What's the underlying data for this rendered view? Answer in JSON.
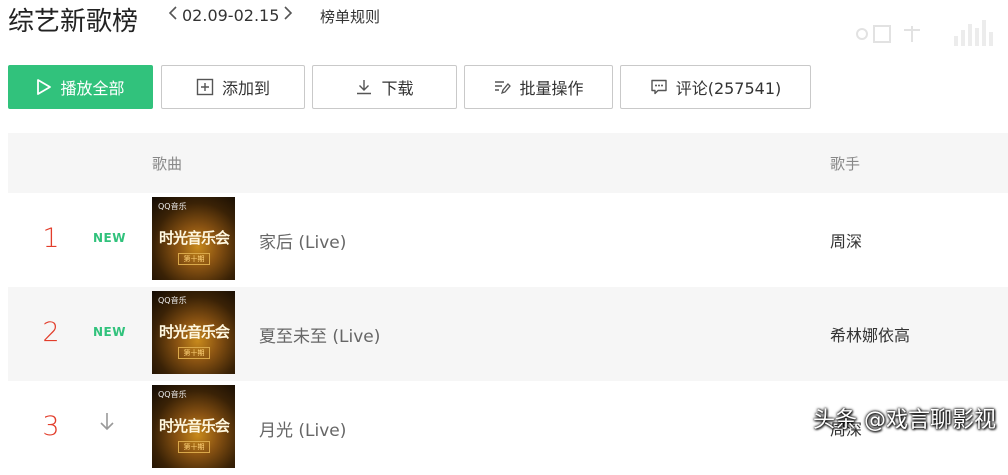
{
  "header": {
    "title": "综艺新歌榜",
    "date_range": "02.09-02.15",
    "rules_label": "榜单规则"
  },
  "toolbar": {
    "play_all": "播放全部",
    "add_to": "添加到",
    "download": "下载",
    "batch": "批量操作",
    "comments": "评论(257541)"
  },
  "table": {
    "col_song": "歌曲",
    "col_singer": "歌手",
    "rows": [
      {
        "rank": "1",
        "badge": "NEW",
        "song": "家后 (Live)",
        "singer": "周深"
      },
      {
        "rank": "2",
        "badge": "NEW",
        "song": "夏至未至 (Live)",
        "singer": "希林娜依高"
      },
      {
        "rank": "3",
        "badge": "",
        "song": "月光 (Live)",
        "singer": "周深"
      }
    ],
    "cover": {
      "brand": "QQ音乐",
      "show": "时光音乐会",
      "episode": "第十期"
    }
  },
  "colors": {
    "accent": "#31c27c",
    "rank": "#e23d2b"
  },
  "watermark": "头条 @戏言聊影视"
}
